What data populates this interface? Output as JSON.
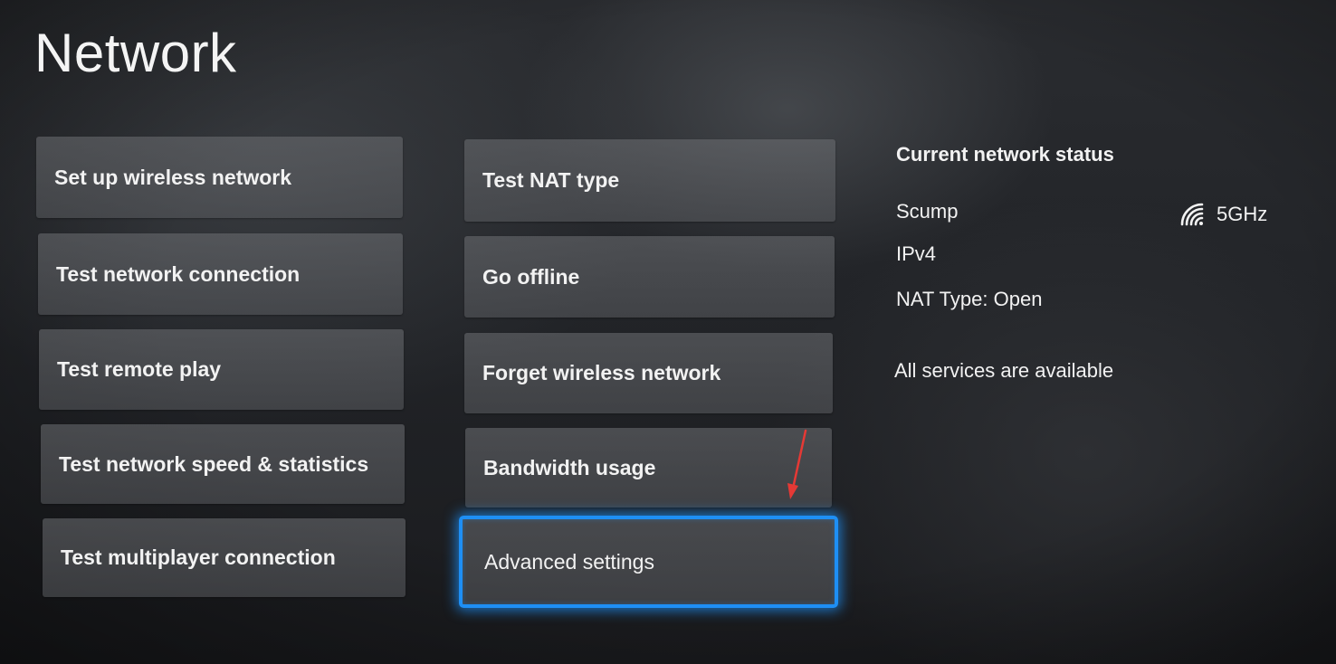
{
  "page": {
    "title": "Network"
  },
  "menu": {
    "left_column": [
      {
        "label": "Set up wireless network"
      },
      {
        "label": "Test network connection"
      },
      {
        "label": "Test remote play"
      },
      {
        "label": "Test network speed & statistics"
      },
      {
        "label": "Test multiplayer connection"
      }
    ],
    "right_column": [
      {
        "label": "Test NAT type"
      },
      {
        "label": "Go offline"
      },
      {
        "label": "Forget wireless network"
      },
      {
        "label": "Bandwidth usage"
      },
      {
        "label": "Advanced settings",
        "focused": true
      }
    ]
  },
  "status": {
    "title": "Current network status",
    "network_name": "Scump",
    "band": "5GHz",
    "band_icon": "wifi-signal-icon",
    "ip_version": "IPv4",
    "nat_type": "NAT Type: Open",
    "services": "All services are available"
  },
  "annotation": {
    "icon": "red-arrow-icon",
    "color": "#e53935"
  },
  "colors": {
    "focus_ring": "#1e8ff5",
    "text": "#f2f2f2"
  }
}
